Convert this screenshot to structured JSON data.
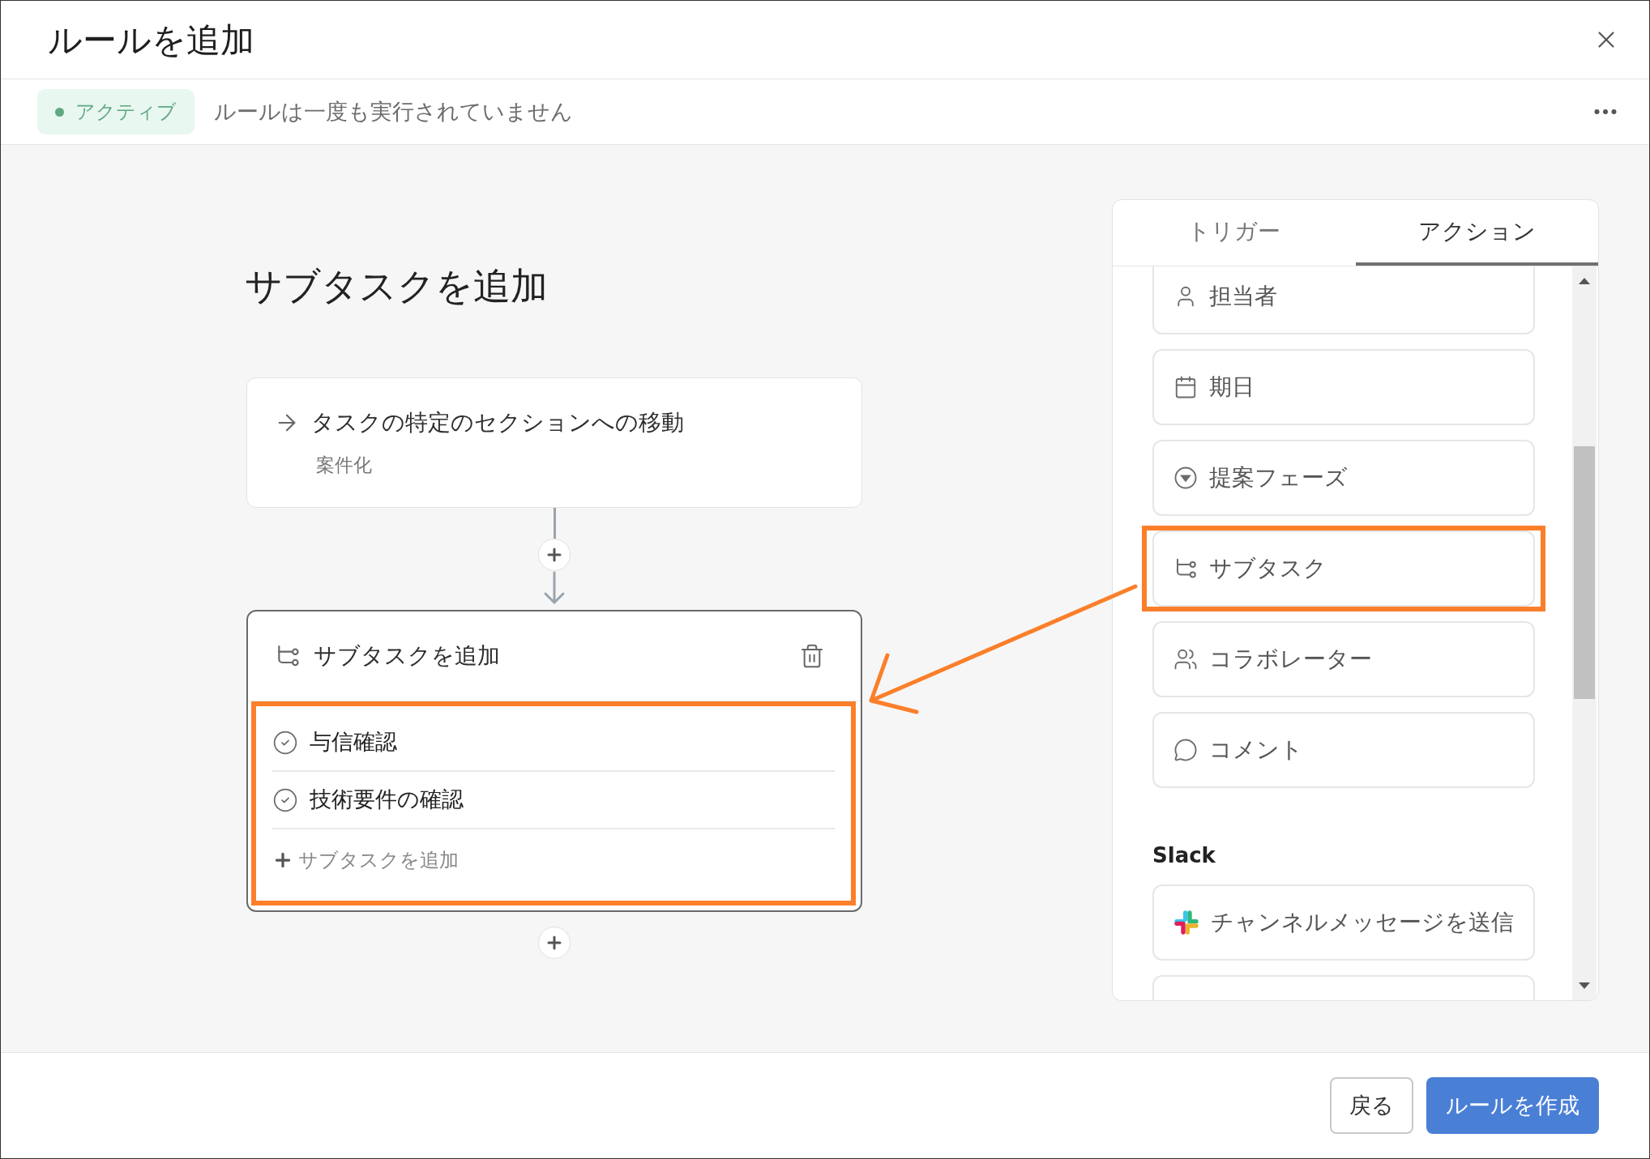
{
  "window": {
    "title": "ルールを追加"
  },
  "status_bar": {
    "badge": {
      "label": "アクティブ",
      "color": "#5fa883"
    },
    "message": "ルールは一度も実行されていません"
  },
  "canvas": {
    "heading": "サブタスクを追加",
    "trigger_card": {
      "title": "タスクの特定のセクションへの移動",
      "subtitle": "案件化"
    },
    "action_card": {
      "title": "サブタスクを追加",
      "highlighted": true,
      "subtasks": [
        {
          "label": "与信確認"
        },
        {
          "label": "技術要件の確認"
        }
      ],
      "add_label": "サブタスクを追加"
    }
  },
  "panel": {
    "tabs": [
      {
        "label": "トリガー",
        "selected": false
      },
      {
        "label": "アクション",
        "selected": true
      }
    ],
    "sections": [
      {
        "items": [
          {
            "kind": "assignee",
            "label": "担当者",
            "highlighted": false
          },
          {
            "kind": "due-date",
            "label": "期日",
            "highlighted": false
          },
          {
            "kind": "field",
            "label": "提案フェーズ",
            "highlighted": false
          },
          {
            "kind": "subtask",
            "label": "サブタスク",
            "highlighted": true
          },
          {
            "kind": "collaborator",
            "label": "コラボレーター",
            "highlighted": false
          },
          {
            "kind": "comment",
            "label": "コメント",
            "highlighted": false
          }
        ]
      },
      {
        "title": "Slack",
        "items": [
          {
            "kind": "slack",
            "label": "チャンネルメッセージを送信",
            "highlighted": false
          },
          {
            "kind": "blank",
            "highlighted": false
          }
        ]
      }
    ]
  },
  "footer": {
    "buttons": [
      {
        "label": "戻る",
        "kind": "secondary"
      },
      {
        "label": "ルールを作成",
        "kind": "primary"
      }
    ]
  }
}
